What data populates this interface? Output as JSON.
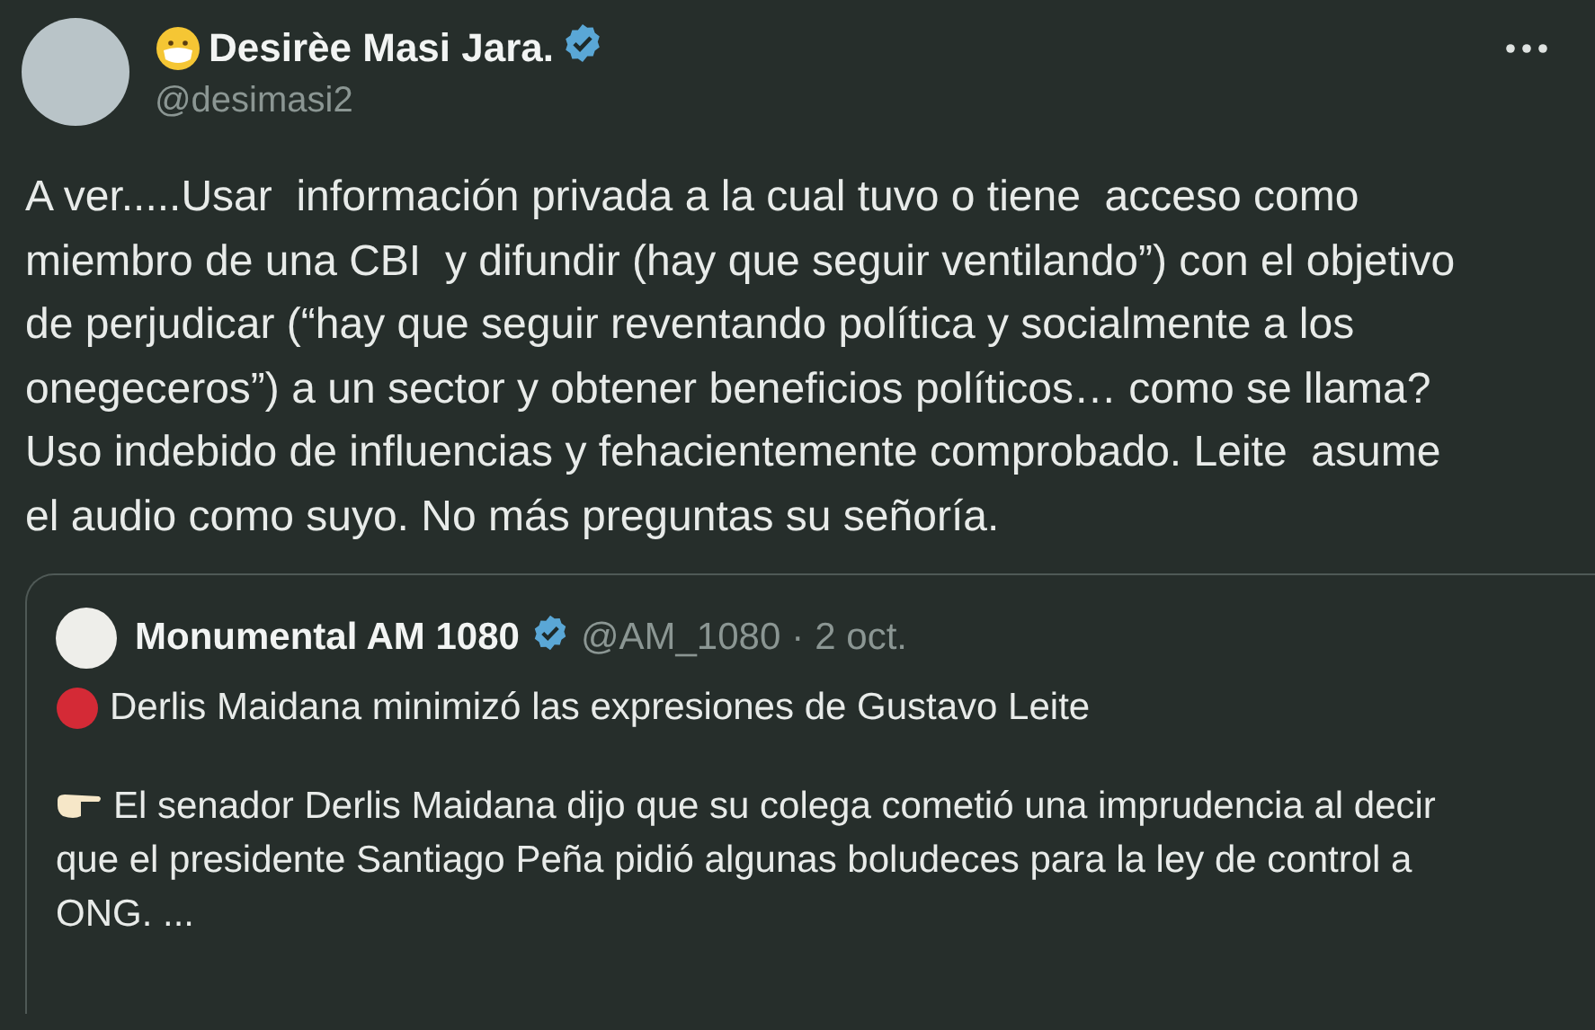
{
  "author": {
    "name": "Desirèe Masi Jara.",
    "handle": "@desimasi2",
    "verified": true
  },
  "text": "A ver.....Usar  información privada a la cual tuvo o tiene  acceso como miembro de una CBI  y difundir (hay que seguir ventilando”) con el objetivo de perjudicar (“hay que seguir reventando política y socialmente a los onegeceros”) a un sector y obtener beneficios políticos… como se llama? Uso indebido de influencias y fehacientemente comprobado. Leite  asume el audio como suyo. No más preguntas su señoría.",
  "quote": {
    "author": {
      "name": "Monumental AM 1080",
      "handle": "@AM_1080",
      "verified": true
    },
    "separator": "·",
    "date": "2 oct.",
    "headline": "Derlis Maidana minimizó las expresiones de Gustavo Leite",
    "text": "El senador Derlis Maidana dijo que su colega cometió una imprudencia al decir que el presidente Santiago Peña pidió algunas boludeces para la ley de control a ONG. ..."
  }
}
